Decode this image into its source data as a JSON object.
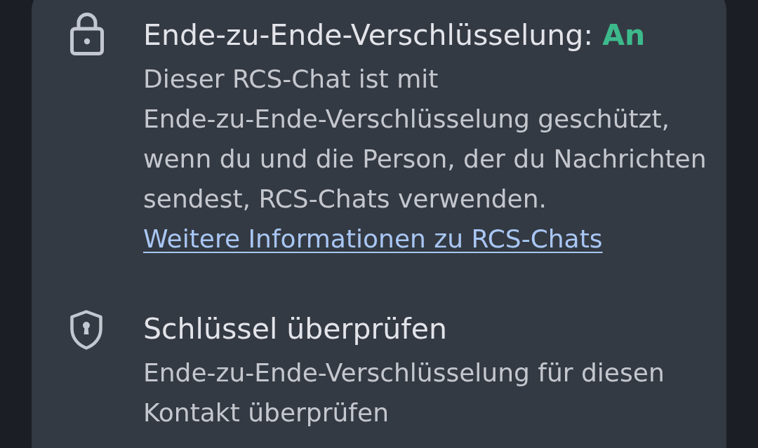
{
  "items": [
    {
      "kind": "lock",
      "title": "Ende-zu-Ende-Verschlüsselung:",
      "status": "An",
      "description": "Dieser RCS-Chat ist mit Ende-zu-Ende-Verschlüsselung geschützt, wenn du und die Person, der du Nachrichten sendest, RCS-Chats verwenden.",
      "link": "Weitere Informationen zu RCS-Chats"
    },
    {
      "kind": "shield",
      "title": "Schlüssel überprüfen",
      "description": "Ende-zu-Ende-Verschlüsselung für diesen Kontakt überprüfen"
    }
  ]
}
